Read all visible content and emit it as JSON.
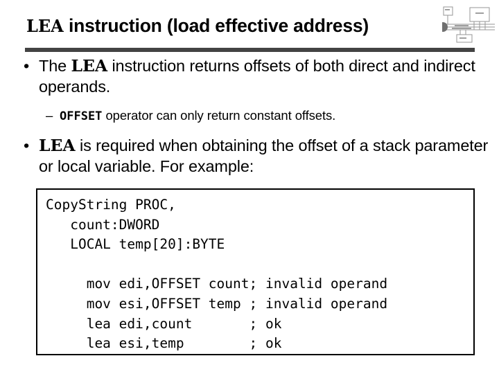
{
  "slide": {
    "title": {
      "mono_prefix": "LEA",
      "rest": " instruction (load effective address)"
    },
    "rule_color": "#434343",
    "corner_graphic_name": "system-bus-block-diagram"
  },
  "bullets": [
    {
      "level": 1,
      "marker": "•",
      "mono_segment": "LEA",
      "text_before": "The ",
      "text_after": " instruction returns offsets of both direct and indirect operands."
    },
    {
      "level": 2,
      "marker": "–",
      "mono_segment": "OFFSET",
      "text_before": "",
      "text_after": " operator can only return constant offsets."
    },
    {
      "level": 1,
      "marker": "•",
      "mono_segment": "LEA",
      "text_before": "",
      "text_after": " is required when obtaining the offset of a stack parameter or local variable. For example:"
    }
  ],
  "code_box": {
    "lines": [
      "CopyString PROC,",
      "   count:DWORD",
      "   LOCAL temp[20]:BYTE",
      "",
      "     mov edi,OFFSET count; invalid operand",
      "     mov esi,OFFSET temp ; invalid operand",
      "     lea edi,count       ; ok",
      "     lea esi,temp        ; ok"
    ]
  }
}
